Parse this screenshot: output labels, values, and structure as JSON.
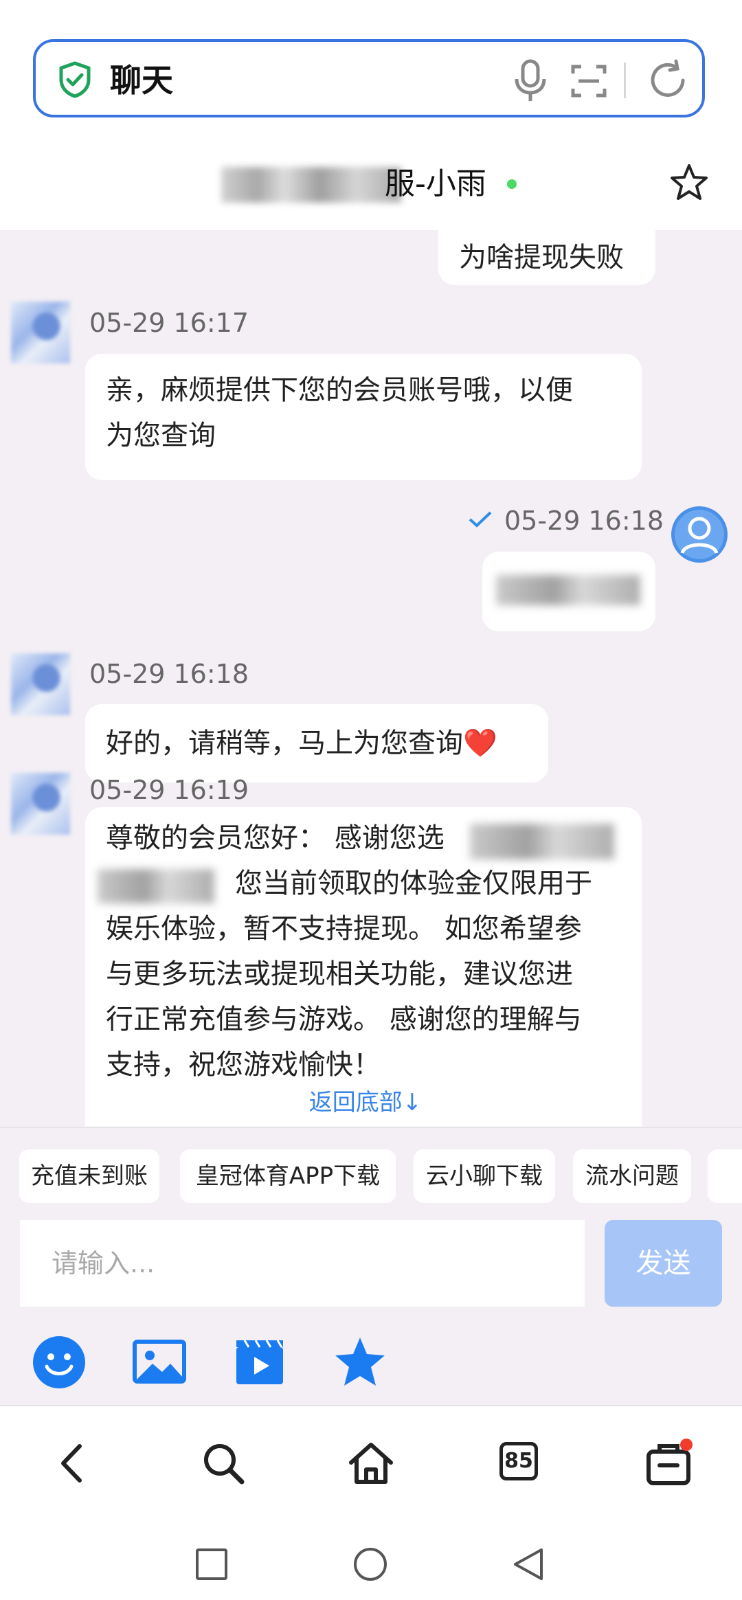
{
  "browser": {
    "url_text": "聊天",
    "icons": [
      "shield-check-icon",
      "microphone-icon",
      "scan-icon",
      "refresh-icon"
    ]
  },
  "chat_header": {
    "title_visible": "服-小雨",
    "status": "online"
  },
  "messages": [
    {
      "side": "right",
      "text": "为啥提现失败"
    },
    {
      "side": "left",
      "time": "05-29 16:17",
      "text_line1": "亲，麻烦提供下您的会员账号哦，以便",
      "text_line2": "为您查询"
    },
    {
      "side": "right",
      "time": "05-29 16:18",
      "status_icon": "check-icon",
      "text": "[blurred]"
    },
    {
      "side": "left",
      "time": "05-29 16:18",
      "text": "好的，请稍等，马上为您查询❤️"
    },
    {
      "side": "left",
      "time": "05-29 16:19",
      "line1": "尊敬的会员您好： 感谢您选",
      "line2": "您当前领取的体验金仅限用于",
      "line3": "娱乐体验，暂不支持提现。 如您希望参",
      "line4": "与更多玩法或提现相关功能，建议您进",
      "line5": "行正常充值参与游戏。 感谢您的理解与",
      "line6": "支持，祝您游戏愉快！"
    }
  ],
  "back_to_bottom": "返回底部↓",
  "quick_replies": [
    "充值未到账",
    "皇冠体育APP下载",
    "云小聊下载",
    "流水问题"
  ],
  "input": {
    "placeholder": "请输入...",
    "send_label": "发送"
  },
  "toolbar_icons": [
    "emoji-icon",
    "image-icon",
    "video-icon",
    "favorite-star-icon"
  ],
  "bottom_nav": {
    "tab_count": "85"
  },
  "colors": {
    "accent": "#3a74e0",
    "chat_bg": "#f4eff5",
    "send_disabled": "#a7c6f7",
    "online": "#4cd964",
    "link_blue": "#3a85e6",
    "icon_blue": "#1a7cf0"
  }
}
